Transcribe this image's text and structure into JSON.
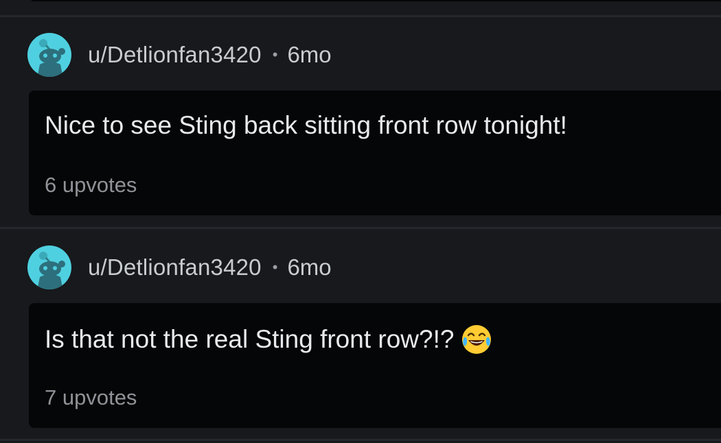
{
  "comments": [
    {
      "username": "u/Detlionfan3420",
      "separator": "•",
      "age": "6mo",
      "text": "Nice to see Sting back sitting front row tonight!",
      "emoji": "",
      "upvotes": "6 upvotes",
      "avatar_icon": "reddit-snoo-avatar-icon"
    },
    {
      "username": "u/Detlionfan3420",
      "separator": "•",
      "age": "6mo",
      "text": "Is that not the real Sting front row?!?",
      "emoji": "face-with-tears-of-joy-icon",
      "upvotes": "7 upvotes",
      "avatar_icon": "reddit-snoo-avatar-icon"
    }
  ],
  "colors": {
    "background": "#17191c",
    "card": "#050607",
    "avatar": "#4fd0e0",
    "text": "#e8eaed",
    "muted": "#8f9398"
  }
}
